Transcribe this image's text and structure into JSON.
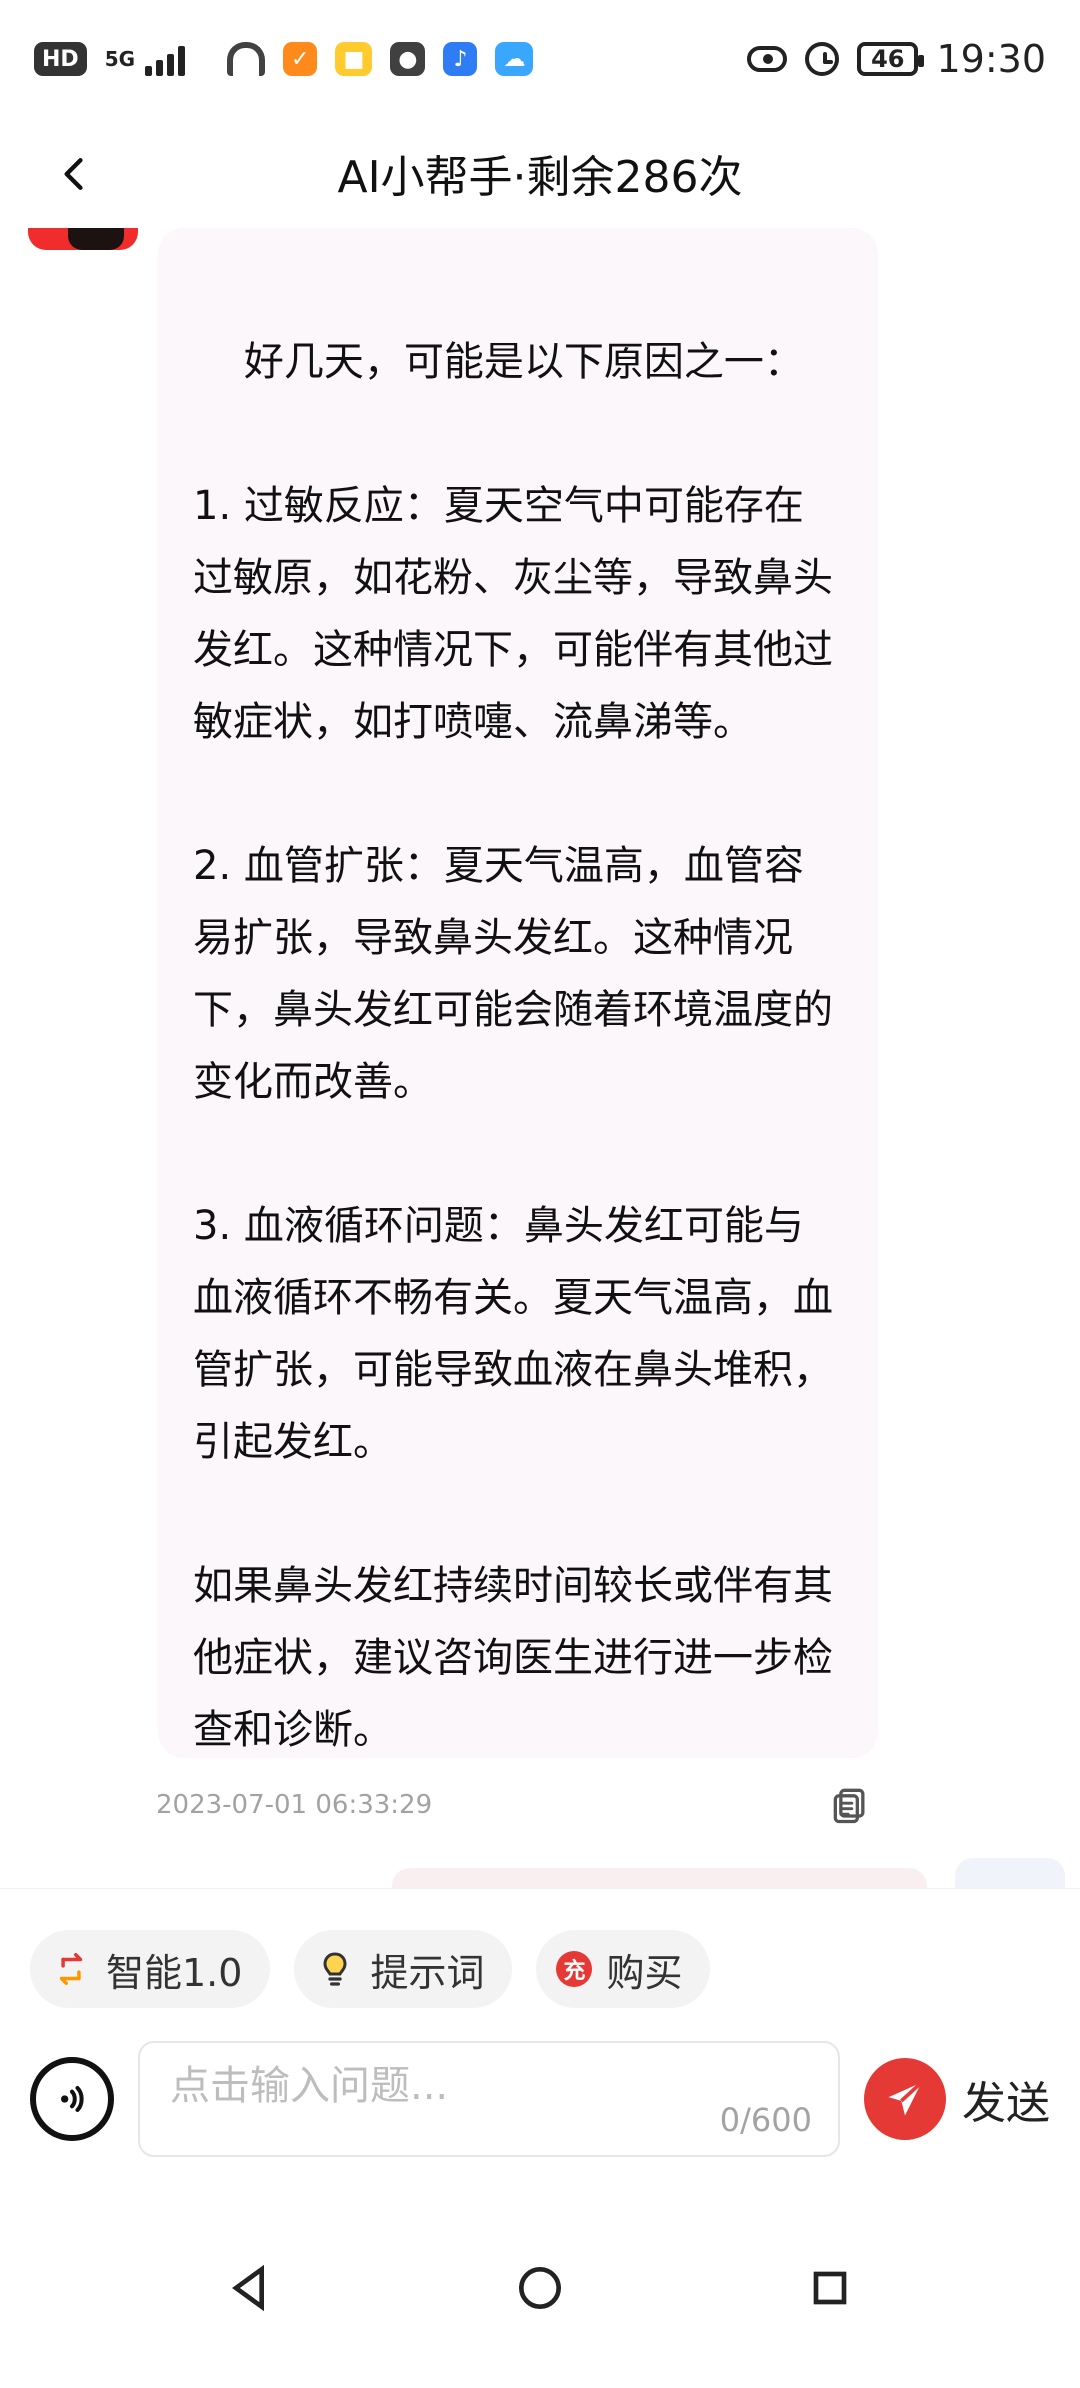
{
  "status_bar": {
    "hd": "HD",
    "network": "5G",
    "battery": "46",
    "time": "19:30"
  },
  "header": {
    "back_icon": "chevron-left-icon",
    "title": "AI小帮手·剩余286次"
  },
  "chat": {
    "message_text": "好几天，可能是以下原因之一：\n\n1. 过敏反应：夏天空气中可能存在过敏原，如花粉、灰尘等，导致鼻头发红。这种情况下，可能伴有其他过敏症状，如打喷嚏、流鼻涕等。\n\n2. 血管扩张：夏天气温高，血管容易扩张，导致鼻头发红。这种情况下，鼻头发红可能会随着环境温度的变化而改善。\n\n3. 血液循环问题：鼻头发红可能与血液循环不畅有关。夏天气温高，血管扩张，可能导致血液在鼻头堆积，引起发红。\n\n如果鼻头发红持续时间较长或伴有其他症状，建议咨询医生进行进一步检查和诊断。",
    "timestamp": "2023-07-01 06:33:29"
  },
  "toolbar": {
    "chips": [
      {
        "label": "智能1.0"
      },
      {
        "label": "提示词"
      },
      {
        "label": "购买",
        "badge": "充"
      }
    ],
    "input": {
      "placeholder": "点击输入问题...",
      "counter": "0/600"
    },
    "send_label": "发送"
  }
}
